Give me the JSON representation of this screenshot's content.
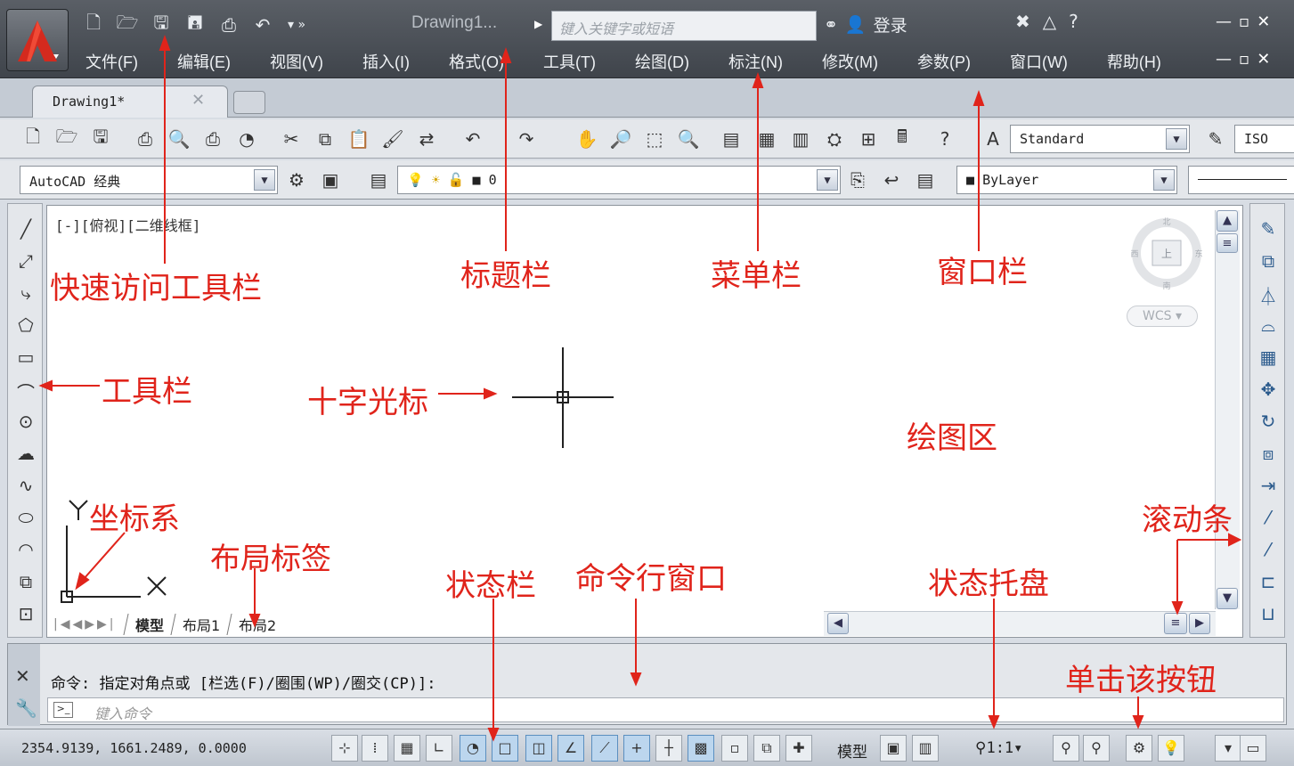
{
  "window": {
    "doc_title": "Drawing1...",
    "search_placeholder": "键入关键字或短语",
    "login": "登录"
  },
  "menubar": [
    "文件(F)",
    "编辑(E)",
    "视图(V)",
    "插入(I)",
    "格式(O)",
    "工具(T)",
    "绘图(D)",
    "标注(N)",
    "修改(M)",
    "参数(P)",
    "窗口(W)",
    "帮助(H)"
  ],
  "tabs": {
    "active": "Drawing1*"
  },
  "toolbar": {
    "text_style": "Standard",
    "dim_style_partial": "ISO",
    "workspace": "AutoCAD 经典",
    "layer": "0",
    "color": "ByLayer"
  },
  "canvas": {
    "view_label": "[-][俯视][二维线框]",
    "wcs": "WCS",
    "axis_x": "X",
    "axis_y": "Y"
  },
  "layout_tabs": [
    "模型",
    "布局1",
    "布局2"
  ],
  "command": {
    "history": "命令: 指定对角点或 [栏选(F)/圈围(WP)/圈交(CP)]:",
    "placeholder": "键入命令"
  },
  "status": {
    "coords": "2354.9139, 1661.2489, 0.0000",
    "model": "模型",
    "scale": "1:1"
  },
  "annotations": {
    "qat": "快速访问工具栏",
    "title_bar": "标题栏",
    "menu_bar": "菜单栏",
    "window_bar": "窗口栏",
    "toolbar": "工具栏",
    "crosshair": "十字光标",
    "drawing_area": "绘图区",
    "ucs": "坐标系",
    "layout_tabs": "布局标签",
    "status_bar": "状态栏",
    "command_window": "命令行窗口",
    "status_tray": "状态托盘",
    "scrollbar": "滚动条",
    "click_button": "单击该按钮"
  },
  "colors": {
    "annotation": "#e0241b",
    "titlebar": "#4a4f56"
  }
}
